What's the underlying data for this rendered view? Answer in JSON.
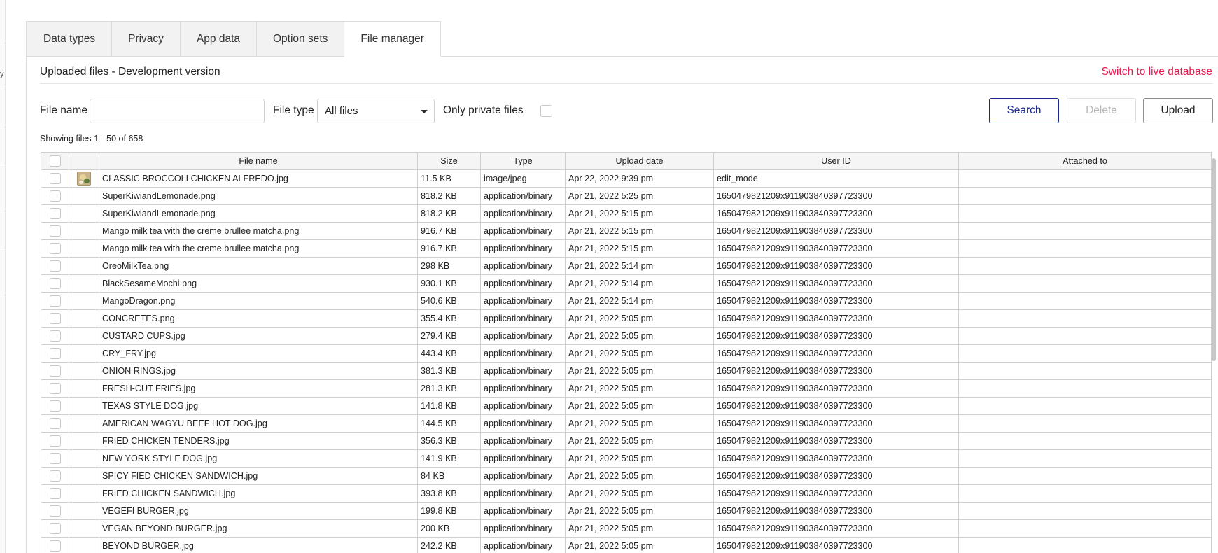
{
  "sidebar_glyph": "y",
  "tabs": [
    {
      "label": "Data types",
      "name": "tab-data-types"
    },
    {
      "label": "Privacy",
      "name": "tab-privacy"
    },
    {
      "label": "App data",
      "name": "tab-app-data"
    },
    {
      "label": "Option sets",
      "name": "tab-option-sets"
    },
    {
      "label": "File manager",
      "name": "tab-file-manager",
      "active": true
    }
  ],
  "header": {
    "subtitle": "Uploaded files - Development version",
    "switch_link": "Switch to live database"
  },
  "filters": {
    "file_name_label": "File name",
    "file_name_value": "",
    "file_type_label": "File type",
    "file_type_value": "All files",
    "only_private_label": "Only private files",
    "only_private_checked": false
  },
  "buttons": {
    "search": "Search",
    "delete": "Delete",
    "upload": "Upload"
  },
  "showing": "Showing files 1 - 50 of 658",
  "colors": {
    "accent_link": "#e8174b",
    "search_border": "#1a2a8c",
    "disabled_text": "#b8b8b8"
  },
  "table": {
    "columns": [
      "",
      "",
      "File name",
      "Size",
      "Type",
      "Upload date",
      "User ID",
      "Attached to"
    ],
    "rows": [
      {
        "thumbnail": true,
        "name": "CLASSIC BROCCOLI CHICKEN ALFREDO.jpg",
        "size": "11.5 KB",
        "type": "image/jpeg",
        "date": "Apr 22, 2022 9:39 pm",
        "user": "edit_mode",
        "attached": ""
      },
      {
        "name": "SuperKiwiandLemonade.png",
        "size": "818.2 KB",
        "type": "application/binary",
        "date": "Apr 21, 2022 5:25 pm",
        "user": "1650479821209x911903840397723300",
        "attached": ""
      },
      {
        "name": "SuperKiwiandLemonade.png",
        "size": "818.2 KB",
        "type": "application/binary",
        "date": "Apr 21, 2022 5:15 pm",
        "user": "1650479821209x911903840397723300",
        "attached": ""
      },
      {
        "name": "Mango milk tea with the creme brullee matcha.png",
        "size": "916.7 KB",
        "type": "application/binary",
        "date": "Apr 21, 2022 5:15 pm",
        "user": "1650479821209x911903840397723300",
        "attached": ""
      },
      {
        "name": "Mango milk tea with the creme brullee matcha.png",
        "size": "916.7 KB",
        "type": "application/binary",
        "date": "Apr 21, 2022 5:15 pm",
        "user": "1650479821209x911903840397723300",
        "attached": ""
      },
      {
        "name": "OreoMilkTea.png",
        "size": "298 KB",
        "type": "application/binary",
        "date": "Apr 21, 2022 5:14 pm",
        "user": "1650479821209x911903840397723300",
        "attached": ""
      },
      {
        "name": "BlackSesameMochi.png",
        "size": "930.1 KB",
        "type": "application/binary",
        "date": "Apr 21, 2022 5:14 pm",
        "user": "1650479821209x911903840397723300",
        "attached": ""
      },
      {
        "name": "MangoDragon.png",
        "size": "540.6 KB",
        "type": "application/binary",
        "date": "Apr 21, 2022 5:14 pm",
        "user": "1650479821209x911903840397723300",
        "attached": ""
      },
      {
        "name": "CONCRETES.png",
        "size": "355.4 KB",
        "type": "application/binary",
        "date": "Apr 21, 2022 5:05 pm",
        "user": "1650479821209x911903840397723300",
        "attached": ""
      },
      {
        "name": "CUSTARD CUPS.jpg",
        "size": "279.4 KB",
        "type": "application/binary",
        "date": "Apr 21, 2022 5:05 pm",
        "user": "1650479821209x911903840397723300",
        "attached": ""
      },
      {
        "name": "CRY_FRY.jpg",
        "size": "443.4 KB",
        "type": "application/binary",
        "date": "Apr 21, 2022 5:05 pm",
        "user": "1650479821209x911903840397723300",
        "attached": ""
      },
      {
        "name": "ONION RINGS.jpg",
        "size": "381.3 KB",
        "type": "application/binary",
        "date": "Apr 21, 2022 5:05 pm",
        "user": "1650479821209x911903840397723300",
        "attached": ""
      },
      {
        "name": "FRESH-CUT FRIES.jpg",
        "size": "281.3 KB",
        "type": "application/binary",
        "date": "Apr 21, 2022 5:05 pm",
        "user": "1650479821209x911903840397723300",
        "attached": ""
      },
      {
        "name": "TEXAS STYLE DOG.jpg",
        "size": "141.8 KB",
        "type": "application/binary",
        "date": "Apr 21, 2022 5:05 pm",
        "user": "1650479821209x911903840397723300",
        "attached": ""
      },
      {
        "name": "AMERICAN WAGYU BEEF HOT DOG.jpg",
        "size": "144.5 KB",
        "type": "application/binary",
        "date": "Apr 21, 2022 5:05 pm",
        "user": "1650479821209x911903840397723300",
        "attached": ""
      },
      {
        "name": "FRIED CHICKEN TENDERS.jpg",
        "size": "356.3 KB",
        "type": "application/binary",
        "date": "Apr 21, 2022 5:05 pm",
        "user": "1650479821209x911903840397723300",
        "attached": ""
      },
      {
        "name": "NEW YORK STYLE DOG.jpg",
        "size": "141.9 KB",
        "type": "application/binary",
        "date": "Apr 21, 2022 5:05 pm",
        "user": "1650479821209x911903840397723300",
        "attached": ""
      },
      {
        "name": "SPICY FIED CHICKEN SANDWICH.jpg",
        "size": "84 KB",
        "type": "application/binary",
        "date": "Apr 21, 2022 5:05 pm",
        "user": "1650479821209x911903840397723300",
        "attached": ""
      },
      {
        "name": "FRIED CHICKEN SANDWICH.jpg",
        "size": "393.8 KB",
        "type": "application/binary",
        "date": "Apr 21, 2022 5:05 pm",
        "user": "1650479821209x911903840397723300",
        "attached": ""
      },
      {
        "name": "VEGEFI BURGER.jpg",
        "size": "199.8 KB",
        "type": "application/binary",
        "date": "Apr 21, 2022 5:05 pm",
        "user": "1650479821209x911903840397723300",
        "attached": ""
      },
      {
        "name": "VEGAN BEYOND BURGER.jpg",
        "size": "200 KB",
        "type": "application/binary",
        "date": "Apr 21, 2022 5:05 pm",
        "user": "1650479821209x911903840397723300",
        "attached": ""
      },
      {
        "name": "BEYOND BURGER.jpg",
        "size": "242.2 KB",
        "type": "application/binary",
        "date": "Apr 21, 2022 5:05 pm",
        "user": "1650479821209x911903840397723300",
        "attached": ""
      }
    ]
  }
}
